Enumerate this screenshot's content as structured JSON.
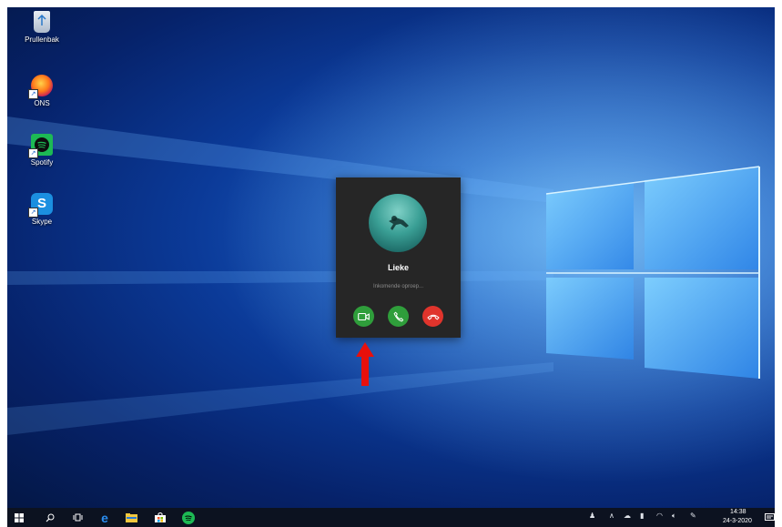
{
  "desktop": {
    "icons": [
      {
        "label": "Prullenbak"
      },
      {
        "label": "ONS"
      },
      {
        "label": "Spotify"
      },
      {
        "label": "Skype"
      }
    ]
  },
  "incoming_call": {
    "caller_name": "Lieke",
    "status": "Inkomende oproep...",
    "buttons": [
      {
        "action": "answer-video",
        "icon": "video-camera-icon",
        "color": "#2f9e3b"
      },
      {
        "action": "answer-audio",
        "icon": "phone-icon",
        "color": "#2f9e3b"
      },
      {
        "action": "decline",
        "icon": "hang-up-icon",
        "color": "#e0342c"
      }
    ]
  },
  "annotation": {
    "icon": "red-arrow-up",
    "color": "#e8100c"
  },
  "taskbar": {
    "pinned": [
      "start-icon",
      "search-icon",
      "task-view-icon",
      "edge-icon",
      "file-explorer-icon",
      "store-icon",
      "spotify-icon"
    ],
    "tray": [
      "people-icon",
      "chevron-up-icon",
      "onedrive-icon",
      "battery-icon",
      "wifi-icon",
      "volume-icon",
      "pen-icon"
    ],
    "clock": {
      "time": "14:38",
      "date": "24-3-2020"
    }
  }
}
